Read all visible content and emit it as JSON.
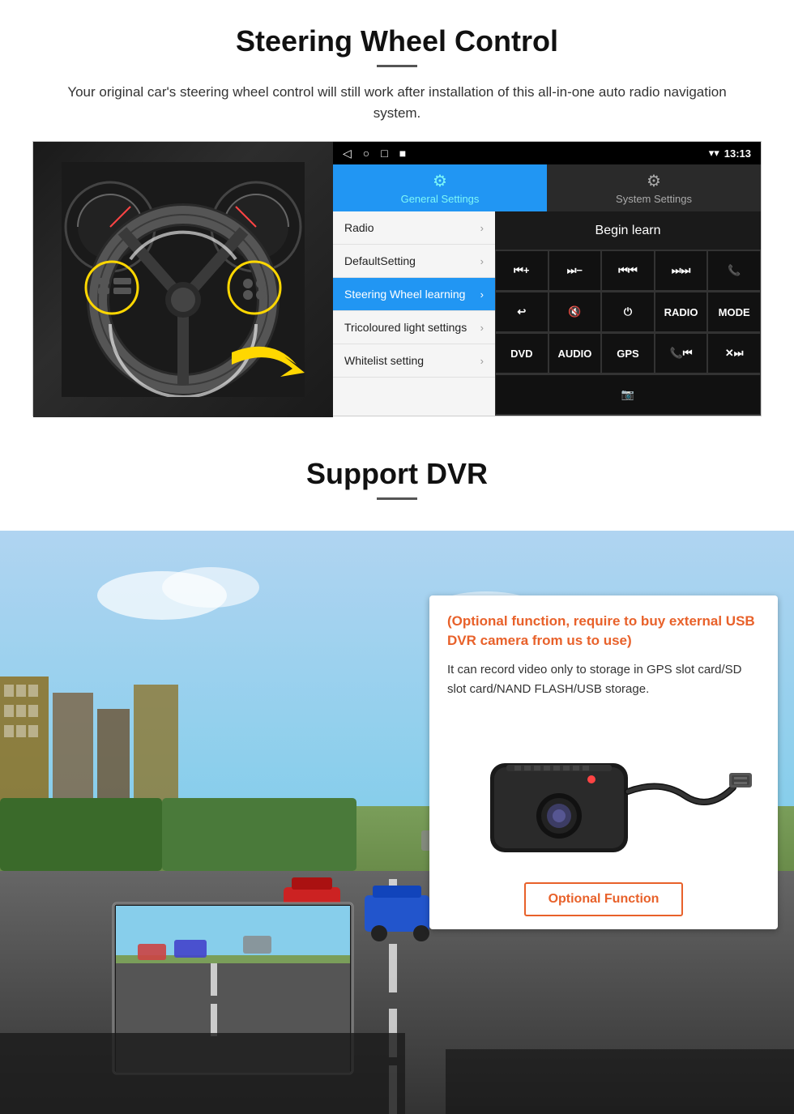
{
  "steering": {
    "title": "Steering Wheel Control",
    "subtitle": "Your original car's steering wheel control will still work after installation of this all-in-one auto radio navigation system.",
    "status_bar": {
      "time": "13:13",
      "nav_icons": [
        "◁",
        "○",
        "□",
        "■"
      ],
      "signal_icons": [
        "▾",
        "▾"
      ]
    },
    "tabs": [
      {
        "label": "General Settings",
        "icon": "⚙",
        "active": true
      },
      {
        "label": "System Settings",
        "icon": "🔧",
        "active": false
      }
    ],
    "menu_items": [
      {
        "label": "Radio",
        "active": false
      },
      {
        "label": "DefaultSetting",
        "active": false
      },
      {
        "label": "Steering Wheel learning",
        "active": true
      },
      {
        "label": "Tricoloured light settings",
        "active": false
      },
      {
        "label": "Whitelist setting",
        "active": false
      }
    ],
    "begin_learn": "Begin learn",
    "control_buttons_row1": [
      "⏮+",
      "⏭-",
      "⏮⏮",
      "⏭⏭",
      "📞"
    ],
    "control_buttons_row2": [
      "↩",
      "🔇",
      "⏻",
      "RADIO",
      "MODE"
    ],
    "control_buttons_row3": [
      "DVD",
      "AUDIO",
      "GPS",
      "📞⏮",
      "✕⏭"
    ],
    "control_buttons_row4": [
      "📷"
    ]
  },
  "dvr": {
    "title": "Support DVR",
    "optional_title": "(Optional function, require to buy external USB DVR camera from us to use)",
    "description": "It can record video only to storage in GPS slot card/SD slot card/NAND FLASH/USB storage.",
    "optional_button": "Optional Function"
  },
  "colors": {
    "accent_blue": "#2196F3",
    "accent_orange": "#e8612a",
    "dark_bg": "#1a1a1a",
    "menu_bg": "#f5f5f5"
  }
}
